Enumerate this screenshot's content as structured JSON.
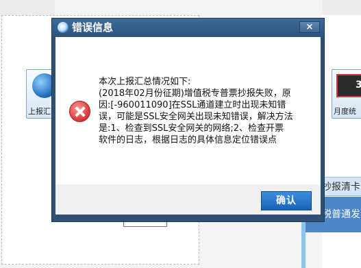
{
  "background": {
    "tile_left_label": "上报汇",
    "tile_right_label": "月度统",
    "tile_right_number": "3",
    "banner_text": "抄报清卡",
    "block_text": "税普通发"
  },
  "dialog": {
    "title": "错误信息",
    "close_label": "×",
    "message_lines": [
      "本次上报汇总情况如下:",
      "(2018年02月份征期)增值税专普票抄报失败，原",
      "因:[-960011090]在SSL通道建立时出现未知错",
      "误，可能是SSL安全网关出现未知错误，解决方法",
      "是:1、检查到SSL安全网关的网络;2、检查开票",
      "软件的日志，根据日志的具体信息定位错误点"
    ],
    "ok_label": "确认"
  },
  "colors": {
    "titlebar": "#3d6a98",
    "dialog_frame": "#2f4f74",
    "ok_button": "#1b63b8",
    "error_icon": "#e04848"
  },
  "icons": {
    "app": "app-logo-icon",
    "error": "error-x-icon",
    "close": "close-icon"
  }
}
